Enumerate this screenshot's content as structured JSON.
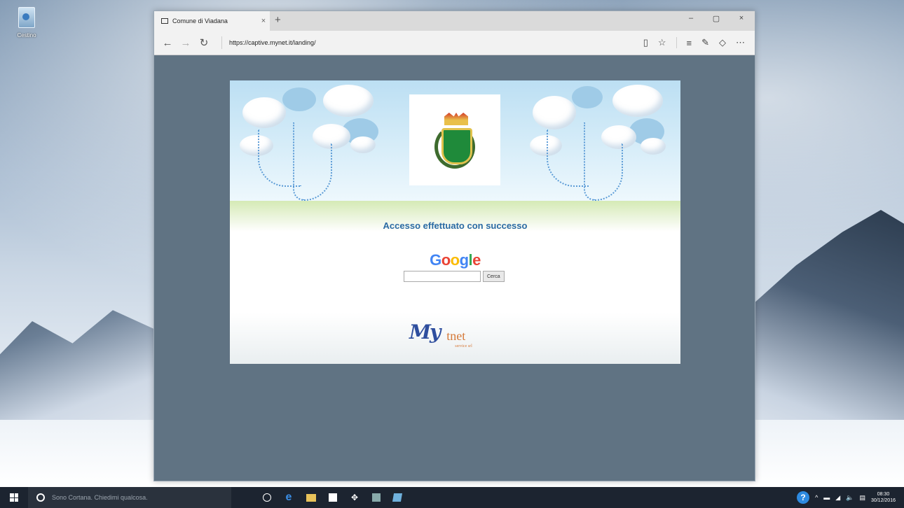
{
  "desktop": {
    "recycle_bin_label": "Cestino"
  },
  "browser": {
    "tab_title": "Comune di Viadana",
    "tab_close": "×",
    "new_tab": "+",
    "window_controls": {
      "minimize": "–",
      "maximize": "▢",
      "close": "×"
    },
    "nav": {
      "back": "←",
      "forward": "→",
      "refresh": "↻"
    },
    "url": "https://captive.mynet.it/landing/",
    "tools": {
      "reading_view": "▯",
      "favorites": "☆",
      "hub": "≡",
      "notes": "✎",
      "share": "◇",
      "more": "⋯"
    }
  },
  "page": {
    "success_message": "Accesso effettuato con successo",
    "google_logo": [
      "G",
      "o",
      "o",
      "g",
      "l",
      "e"
    ],
    "search_placeholder": "",
    "search_button": "Cerca",
    "my_logo": "My",
    "tnet_logo": "tnet",
    "tnet_sub": "service srl"
  },
  "taskbar": {
    "cortana_placeholder": "Sono Cortana. Chiedimi qualcosa.",
    "apps": [
      "task-view",
      "edge",
      "file-explorer",
      "store",
      "dropbox",
      "app-5",
      "app-6"
    ],
    "tray_icons": [
      "chevron-up",
      "battery",
      "network",
      "volume",
      "notifications"
    ],
    "time": "08:30",
    "date": "30/12/2016"
  }
}
